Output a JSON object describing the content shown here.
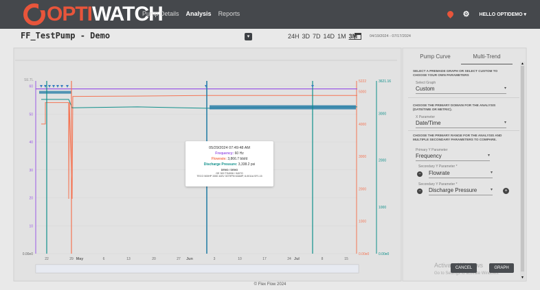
{
  "app": {
    "logo_opti": "OPTI",
    "logo_watch": "WATCH",
    "nav": [
      {
        "label": "Pump Details",
        "active": false
      },
      {
        "label": "Analysis",
        "active": true
      },
      {
        "label": "Reports",
        "active": false
      }
    ],
    "user_greeting": "HELLO OPTIDEMO"
  },
  "page": {
    "title": "FF_TestPump - Demo",
    "ranges": [
      {
        "label": "24H",
        "selected": false
      },
      {
        "label": "3D",
        "selected": false
      },
      {
        "label": "7D",
        "selected": false
      },
      {
        "label": "14D",
        "selected": false
      },
      {
        "label": "1M",
        "selected": false
      },
      {
        "label": "3M",
        "selected": true
      }
    ],
    "date_range": "04/19/2024 - 07/17/2024"
  },
  "chart_data": {
    "type": "line",
    "legend": [
      "Frequency",
      "Flowrate",
      "Discharge Pressure"
    ],
    "colors": {
      "frequency": "#9b59e6",
      "flowrate": "#f47554",
      "pressure": "#0e8f8a"
    },
    "x_tick_labels": [
      "22",
      "29",
      "May",
      "6",
      "13",
      "20",
      "27",
      "Jun",
      "3",
      "10",
      "17",
      "24",
      "Jul",
      "8",
      "15"
    ],
    "left_axis": {
      "unit_label": "SE.TL",
      "ticks": [
        "0.00e0",
        "10",
        "20",
        "30",
        "40",
        "50",
        "60"
      ],
      "max_label": "60"
    },
    "flow_axis": {
      "ticks": [
        "0.00e0",
        "1000",
        "2000",
        "3000",
        "4000",
        "5000"
      ],
      "max_label": "5222"
    },
    "pressure_axis": {
      "ticks": [
        "0.00e0",
        "1000",
        "2000",
        "3000"
      ],
      "max_label": "3621.16"
    },
    "series": [
      {
        "name": "Frequency",
        "values": [
          59,
          59,
          59,
          59,
          59,
          59,
          59
        ]
      },
      {
        "name": "Flowrate",
        "values": [
          4000,
          4660,
          4850,
          4860,
          4880,
          4880,
          4880
        ]
      },
      {
        "name": "Discharge Pressure",
        "values": [
          3300,
          3120,
          3140,
          3110,
          3130,
          3140,
          3140
        ]
      }
    ]
  },
  "tooltip": {
    "date": "05/29/2024 07:49:48 AM",
    "frequency_label": "Frequency:",
    "frequency_value": "60 Hz",
    "flowrate_label": "Flowrate:",
    "flowrate_value": "3,866.7 bbl/d",
    "pressure_label": "Discharge Pressure:",
    "pressure_value": "3,338.2 psi",
    "pump_name": "DEMO / DEMO",
    "line1": "GE 300 TS4006 / 9407G",
    "line2": "TECO 500HP 3350 440V 307HPM 63AMP, 8-0011A SF1.15"
  },
  "right_panel": {
    "tabs": [
      {
        "label": "Pump Curve",
        "active": false
      },
      {
        "label": "Multi-Trend",
        "active": true
      }
    ],
    "section1_text": "SELECT A PREMADE GRAPH OR SELECT CUSTOM TO CHOOSE YOUR OWN PARAMETERS",
    "select_graph_label": "Select Graph",
    "select_graph_value": "Custom",
    "section2_text": "CHOOSE THE PRIMARY DOMAIN FOR THE ANALYSIS (DATE/TIME OR METRIC).",
    "x_param_label": "X Parameter",
    "x_param_value": "Date/Time",
    "section3_text": "CHOOSE THE PRIMARY RANGE FOR THE ANALYSIS AND MULTIPLE SECONDARY PARAMETERS TO COMPARE.",
    "primary_y_label": "Primary Y Parameter",
    "primary_y_value": "Frequency",
    "secondary_y1_label": "Secondary Y Parameter *",
    "secondary_y1_value": "Flowrate",
    "secondary_y2_label": "Secondary Y Parameter *",
    "secondary_y2_value": "Discharge Pressure",
    "cancel_label": "CANCEL",
    "graph_label": "GRAPH"
  },
  "overlay": {
    "activate_line1": "Activate Windows",
    "activate_line2": "Go to Settings to activate Windows."
  },
  "footer": {
    "text": "© Flex Flow 2024"
  }
}
